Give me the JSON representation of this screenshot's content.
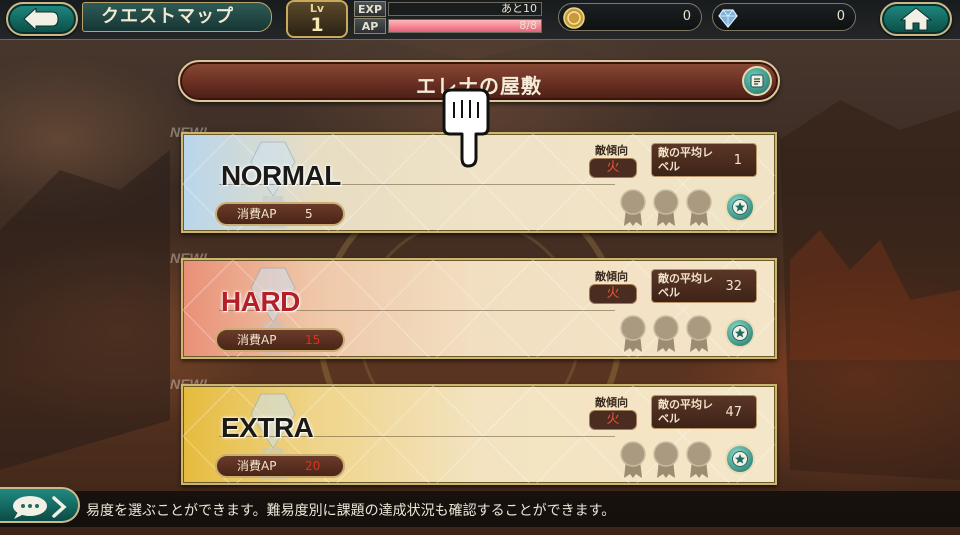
{
  "header": {
    "back_icon": "back-arrow-icon",
    "title": "クエストマップ",
    "level_label": "Lv",
    "level_value": "1",
    "exp_label": "EXP",
    "exp_text": "あと10",
    "exp_progress": 0,
    "ap_label": "AP",
    "ap_text": "8/8",
    "ap_progress": 1,
    "coin_icon": "coin-icon",
    "coin_value": "0",
    "gem_icon": "crystal-icon",
    "gem_value": "0",
    "home_icon": "home-icon"
  },
  "quest": {
    "title": "エレナの屋敷",
    "info_icon": "scroll-info-icon"
  },
  "difficulties": [
    {
      "new_tag": "NEW!",
      "name": "NORMAL",
      "ap_label": "消費AP",
      "ap_value": "5",
      "tendency_label": "敵傾向",
      "tendency_value": "火",
      "avg_label": "敵の平均レベル",
      "avg_value": "1",
      "medals_earned": 0,
      "medals_total": 3
    },
    {
      "new_tag": "NEW!",
      "name": "HARD",
      "ap_label": "消費AP",
      "ap_value": "15",
      "tendency_label": "敵傾向",
      "tendency_value": "火",
      "avg_label": "敵の平均レベル",
      "avg_value": "32",
      "medals_earned": 0,
      "medals_total": 3
    },
    {
      "new_tag": "NEW!",
      "name": "EXTRA",
      "ap_label": "消費AP",
      "ap_value": "20",
      "tendency_label": "敵傾向",
      "tendency_value": "火",
      "avg_label": "敵の平均レベル",
      "avg_value": "47",
      "medals_earned": 0,
      "medals_total": 3
    }
  ],
  "footer": {
    "chat_icon": "speech-bubble-icon",
    "message": "易度を選ぶことができます。難易度別に課題の達成状況も確認することができます。"
  },
  "colors": {
    "teal_button": "#1f8a80",
    "gold_border": "#cdb670",
    "header_plate": "#6a3022",
    "hard_accent": "#b3202a",
    "ap_red": "#d8331d"
  }
}
